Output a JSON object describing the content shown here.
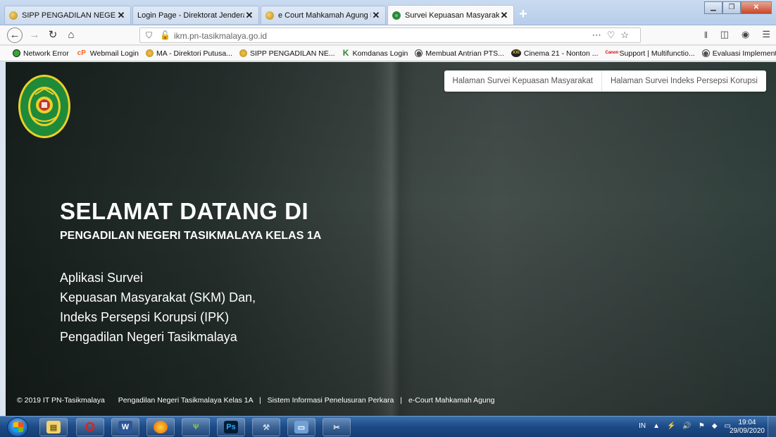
{
  "browser": {
    "tabs": [
      {
        "title": "SIPP PENGADILAN NEGERI TAS",
        "icon": "mahkamah-agung-favicon",
        "active": false
      },
      {
        "title": "Login Page - Direktorat Jenderal Ba",
        "icon": "",
        "active": false
      },
      {
        "title": "e Court Mahkamah Agung RI |",
        "icon": "mahkamah-agung-favicon",
        "active": false
      },
      {
        "title": "Survei Kepuasan Masyarakat (S",
        "icon": "green-circle-favicon",
        "active": true
      }
    ],
    "url": "ikm.pn-tasikmalaya.go.id",
    "bookmarks": [
      {
        "label": "Network Error",
        "icon": "green-dot-icon"
      },
      {
        "label": "Webmail Login",
        "icon": "cpanel-icon"
      },
      {
        "label": "MA - Direktori Putusa...",
        "icon": "mahkamah-agung-icon"
      },
      {
        "label": "SIPP PENGADILAN NE...",
        "icon": "mahkamah-agung-icon"
      },
      {
        "label": "Komdanas Login",
        "icon": "k-icon"
      },
      {
        "label": "Membuat Antrian PTS...",
        "icon": "globe-icon"
      },
      {
        "label": "Cinema 21 - Nonton ...",
        "icon": "xxi-icon"
      },
      {
        "label": "Support | Multifunctio...",
        "icon": "canon-icon"
      },
      {
        "label": "Evaluasi Implementasi...",
        "icon": "globe-icon"
      }
    ]
  },
  "page": {
    "nav": {
      "skm_link": "Halaman Survei Kepuasan Masyarakat",
      "ipk_link": "Halaman Survei Indeks Persepsi Korupsi"
    },
    "hero": {
      "title": "SELAMAT DATANG DI",
      "subtitle": "PENGADILAN NEGERI TASIKMALAYA KELAS 1A",
      "desc_line1": "Aplikasi Survei",
      "desc_line2": "Kepuasan Masyarakat (SKM) Dan,",
      "desc_line3": "Indeks Persepsi Korupsi (IPK)",
      "desc_line4": "Pengadilan Negeri Tasikmalaya"
    },
    "footer": {
      "copyright": "© 2019 IT PN-Tasikmalaya",
      "link1": "Pengadilan Negeri Tasikmalaya Kelas 1A",
      "link2": "Sistem Informasi Penelusuran Perkara",
      "link3": "e-Court Mahkamah Agung",
      "separator": "|"
    }
  },
  "taskbar": {
    "language": "IN",
    "time": "19:04",
    "date": "29/09/2020"
  },
  "colors": {
    "hero_text": "#ffffff",
    "logo_green": "#1f8a3a",
    "logo_gold": "#e9d12a"
  }
}
